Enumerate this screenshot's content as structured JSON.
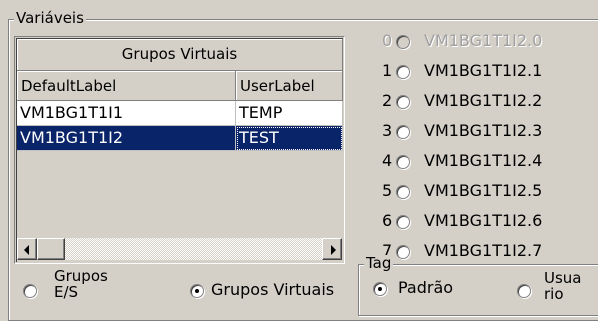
{
  "variables_group": {
    "title": "Variáveis"
  },
  "grid": {
    "group_header": "Grupos Virtuais",
    "columns": [
      "DefaultLabel",
      "UserLabel"
    ],
    "rows": [
      {
        "default_label": "VM1BG1T1I1",
        "user_label": "TEMP",
        "selected": false
      },
      {
        "default_label": "VM1BG1T1I2",
        "user_label": "TEST",
        "selected": true
      }
    ]
  },
  "group_type": {
    "options": [
      {
        "label_line1": "Grupos",
        "label_line2": "E/S",
        "checked": false
      },
      {
        "label": "Grupos Virtuais",
        "checked": true
      }
    ]
  },
  "channels": [
    {
      "index": "0",
      "label": "VM1BG1T1I2.0",
      "enabled": false
    },
    {
      "index": "1",
      "label": "VM1BG1T1I2.1",
      "enabled": true
    },
    {
      "index": "2",
      "label": "VM1BG1T1I2.2",
      "enabled": true
    },
    {
      "index": "3",
      "label": "VM1BG1T1I2.3",
      "enabled": true
    },
    {
      "index": "4",
      "label": "VM1BG1T1I2.4",
      "enabled": true
    },
    {
      "index": "5",
      "label": "VM1BG1T1I2.5",
      "enabled": true
    },
    {
      "index": "6",
      "label": "VM1BG1T1I2.6",
      "enabled": true
    },
    {
      "index": "7",
      "label": "VM1BG1T1I2.7",
      "enabled": true
    }
  ],
  "tag_group": {
    "title": "Tag",
    "options": [
      {
        "label": "Padrão",
        "checked": true
      },
      {
        "label_line1": "Usua",
        "label_line2": "rio",
        "checked": false
      }
    ]
  }
}
